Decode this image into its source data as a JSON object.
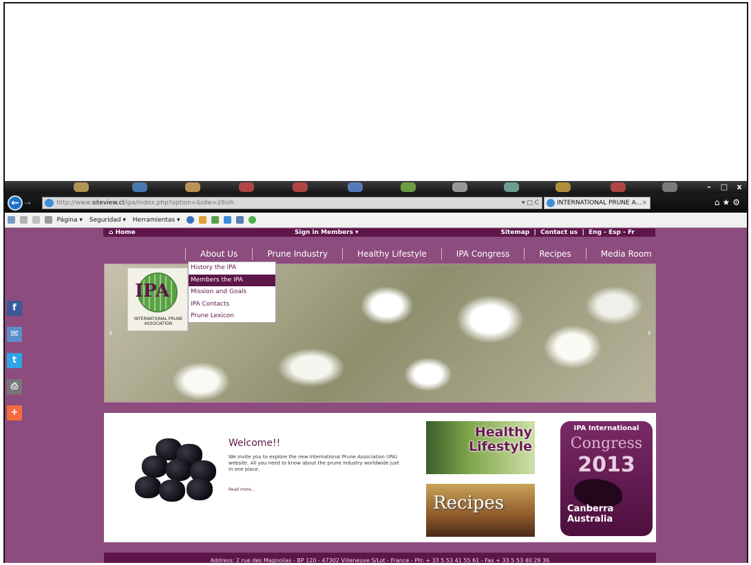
{
  "browser": {
    "address_prefix": "http://www.",
    "address_domain": "siteview.cl",
    "address_rest": "/ipa/index.php?option=&idw=28ish",
    "tab_title": "INTERNATIONAL PRUNE A...",
    "tab_close": "×",
    "window_controls": [
      "–",
      "□",
      "x"
    ]
  },
  "command_bar": {
    "items": [
      "Página ▾",
      "Seguridad ▾",
      "Herramientas ▾"
    ]
  },
  "site": {
    "topnav": {
      "home": "Home",
      "signin": "Sign in Members",
      "sitemap": "Sitemap",
      "contact": "Contact us",
      "lang_en": "Eng",
      "lang_es": "Esp",
      "lang_fr": "Fr"
    },
    "menu": [
      "About Us",
      "Prune Industry",
      "Healthy Lifestyle",
      "IPA Congress",
      "Recipes",
      "Media Room"
    ],
    "dropdown": [
      "History the IPA",
      "Members the IPA",
      "Mission and Goals",
      "IPA Contacts",
      "Prune Lexicon"
    ],
    "logo": {
      "text": "IPA",
      "subtitle": "INTERNATIONAL PRUNE ASSOCIATION"
    },
    "welcome": {
      "title": "Welcome!!",
      "text": "We invite you to explore the new International Prune Association (IPA) website. All you need to know about the prune industry worldwide just in one place.",
      "read_more": "Read more..."
    },
    "promos": {
      "healthy": "Healthy Lifestyle",
      "recipes": "Recipes"
    },
    "congress": {
      "line1": "IPA International",
      "line2": "Congress",
      "year": "2013",
      "city": "Canberra",
      "country": "Australia"
    },
    "footer": "Address: 2 rue des Magnolias - BP 120 - 47302 Villeneuve S/Lot - France - PH: + 33 5 53 41 55 61 - Fax + 33 5 53 40 29 36"
  },
  "colors": {
    "brand": "#5e1549",
    "page_bg": "#8c4c7d"
  }
}
